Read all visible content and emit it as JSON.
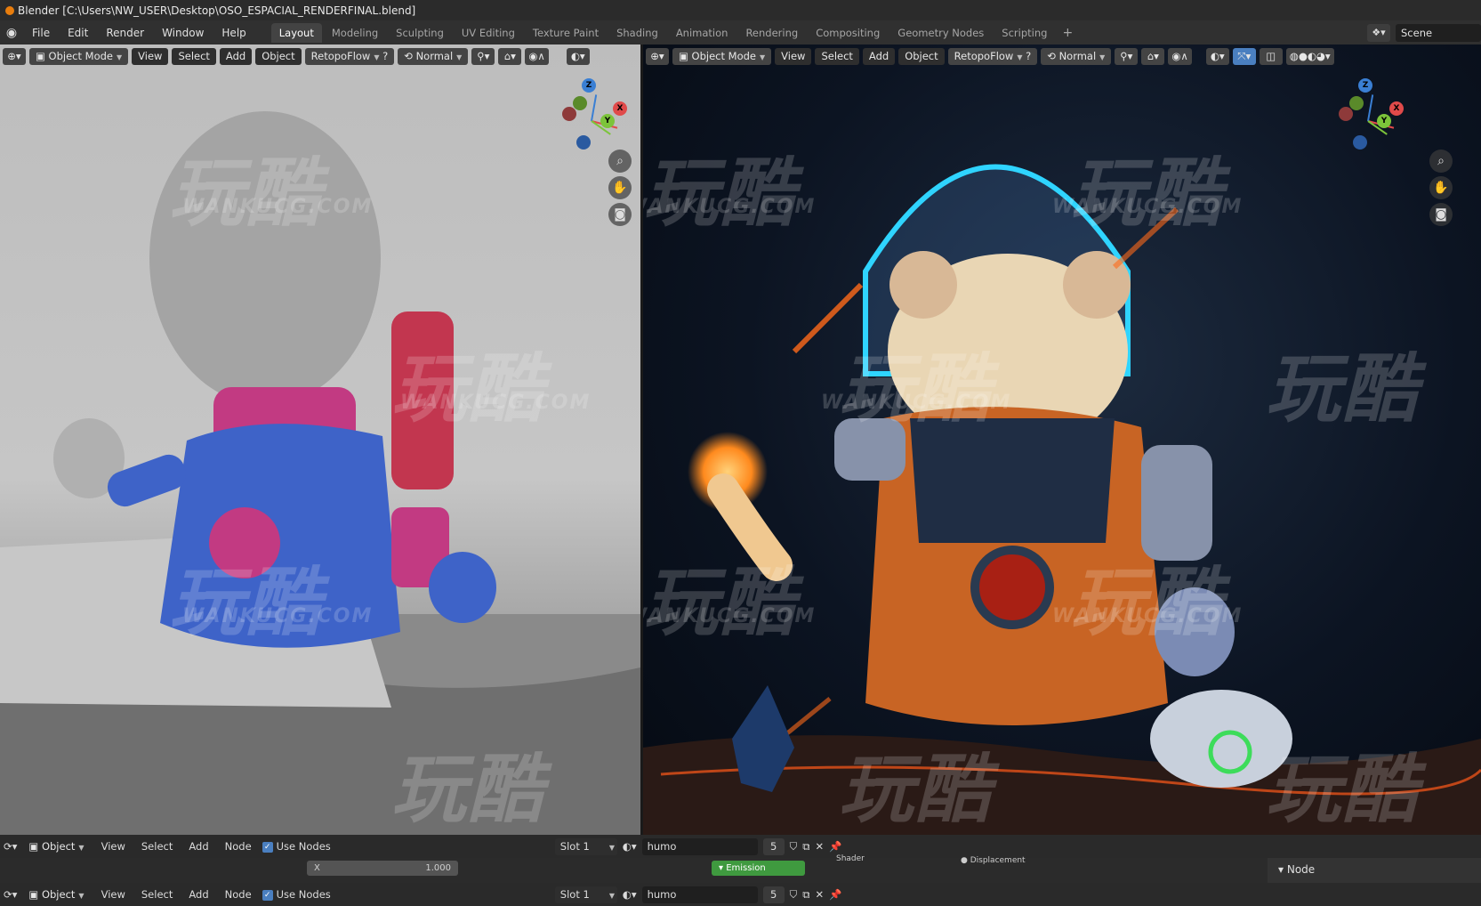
{
  "window": {
    "title": "Blender [C:\\Users\\NW_USER\\Desktop\\OSO_ESPACIAL_RENDERFINAL.blend]"
  },
  "menu": {
    "items": [
      "File",
      "Edit",
      "Render",
      "Window",
      "Help"
    ]
  },
  "workspaces": {
    "tabs": [
      "Layout",
      "Modeling",
      "Sculpting",
      "UV Editing",
      "Texture Paint",
      "Shading",
      "Animation",
      "Rendering",
      "Compositing",
      "Geometry Nodes",
      "Scripting"
    ],
    "active": "Layout"
  },
  "scene": {
    "name": "Scene"
  },
  "viewport_left": {
    "mode": "Object Mode",
    "menus": [
      "View",
      "Select",
      "Add",
      "Object"
    ],
    "addon": "RetopoFlow",
    "orientation": "Normal",
    "gizmo_axes": [
      "Z",
      "Y",
      "X"
    ]
  },
  "viewport_right": {
    "mode": "Object Mode",
    "menus": [
      "View",
      "Select",
      "Add",
      "Object"
    ],
    "addon": "RetopoFlow",
    "orientation": "Normal",
    "gizmo_axes": [
      "Z",
      "Y",
      "X"
    ]
  },
  "watermark": {
    "brand_cn": "玩酷",
    "url": "WANKUCG.COM"
  },
  "node_editor_top": {
    "object": "Object",
    "menus": [
      "View",
      "Select",
      "Add",
      "Node"
    ],
    "use_nodes_label": "Use Nodes",
    "slot": "Slot 1",
    "material": "humo",
    "users": "5",
    "strength_label": "X",
    "strength_value": "1.000",
    "emission_node": "Emission",
    "shader_label": "Shader",
    "displacement_label": "Displacement",
    "sidebar_tab": "Node"
  },
  "node_editor_bottom": {
    "object": "Object",
    "menus": [
      "View",
      "Select",
      "Add",
      "Node"
    ],
    "use_nodes_label": "Use Nodes",
    "slot": "Slot 1",
    "material": "humo",
    "users": "5"
  },
  "colors": {
    "accent": "#e87d0d",
    "axis_x": "#e04a4a",
    "axis_y": "#7cc43a",
    "axis_z": "#3a7fd4",
    "emission_node": "#3f9a3f"
  }
}
